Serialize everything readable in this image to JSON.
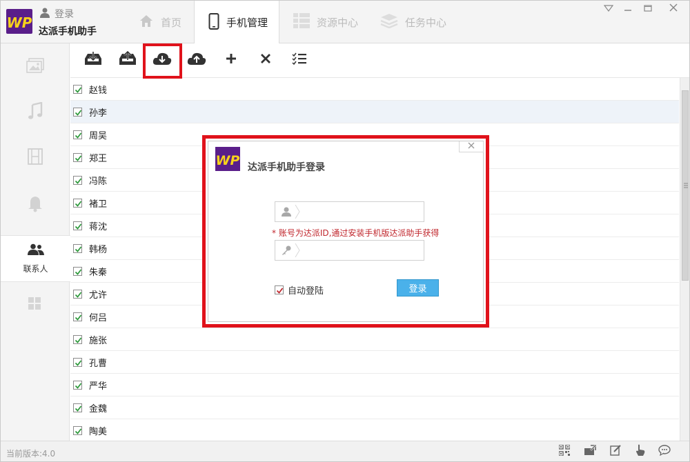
{
  "app": {
    "name": "达派手机助手",
    "login_link": "登录",
    "logo_text": "WP"
  },
  "nav_tabs": [
    {
      "label": "首页",
      "icon": "home-icon"
    },
    {
      "label": "手机管理",
      "icon": "phone-icon"
    },
    {
      "label": "资源中心",
      "icon": "grid-icon"
    },
    {
      "label": "任务中心",
      "icon": "layers-icon"
    }
  ],
  "window_controls": [
    "menu-icon",
    "minimize-icon",
    "maximize-icon",
    "close-icon"
  ],
  "sidebar": {
    "items": [
      {
        "icon": "photo-icon",
        "label": ""
      },
      {
        "icon": "music-icon",
        "label": ""
      },
      {
        "icon": "video-icon",
        "label": ""
      },
      {
        "icon": "bell-icon",
        "label": ""
      },
      {
        "icon": "contacts-icon",
        "label": "联系人"
      },
      {
        "icon": "apps-icon",
        "label": ""
      }
    ]
  },
  "toolbar": {
    "tools": [
      "download-tray-icon",
      "upload-tray-icon",
      "cloud-download-icon",
      "cloud-upload-icon",
      "plus-icon",
      "delete-icon",
      "checklist-icon"
    ]
  },
  "contacts": [
    "赵钱",
    "孙李",
    "周吴",
    "郑王",
    "冯陈",
    "褚卫",
    "蒋沈",
    "韩杨",
    "朱秦",
    "尤许",
    "何吕",
    "施张",
    "孔曹",
    "严华",
    "金魏",
    "陶美"
  ],
  "status": {
    "version": "当前版本:4.0",
    "icons": [
      "qrcode-icon",
      "export-icon",
      "edit-icon",
      "pointer-icon",
      "chat-icon"
    ]
  },
  "dialog": {
    "title": "达派手机助手登录",
    "username_placeholder": "",
    "password_placeholder": "",
    "hint": "* 账号为达派ID,通过安装手机版达派助手获得",
    "auto_login_label": "自动登陆",
    "auto_login_checked": true,
    "login_button": "登录"
  },
  "colors": {
    "highlight": "#e0121b",
    "brand": "#5a1e8a",
    "brand_accent": "#f7d21b",
    "button": "#4ab1ea",
    "hint": "#c0272d",
    "check": "#2f9a3d"
  }
}
